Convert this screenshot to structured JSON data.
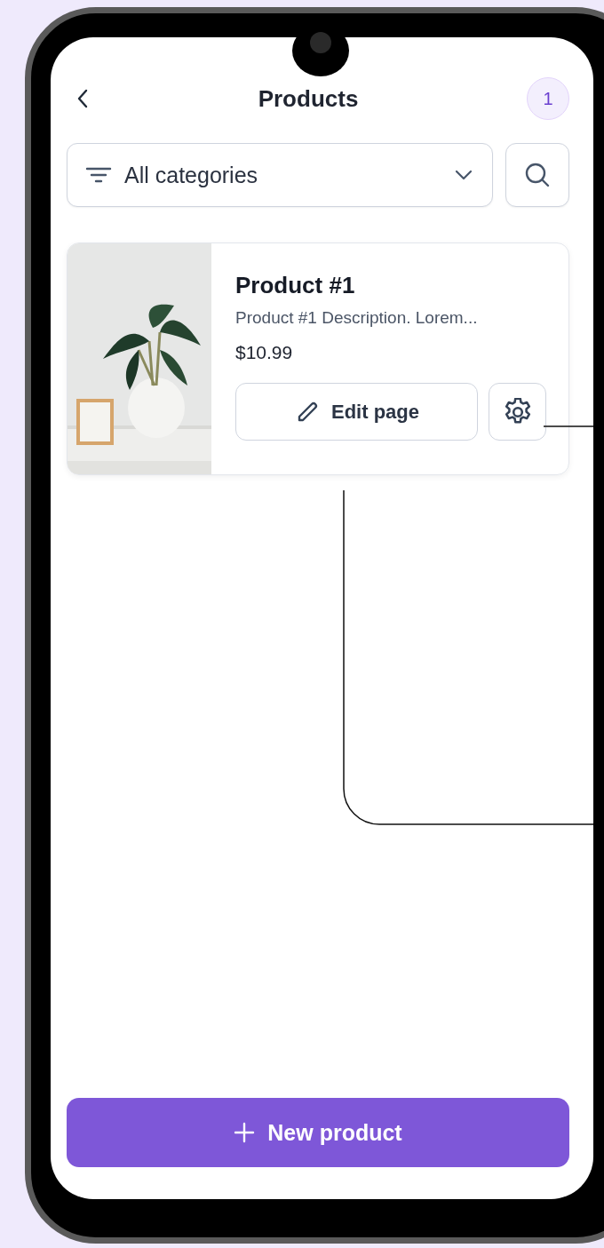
{
  "header": {
    "title": "Products",
    "badge": "1"
  },
  "filter": {
    "value": "All categories"
  },
  "products": [
    {
      "kind": "picture",
      "title": "Product #1",
      "description": "Product #1 Description. Lorem...",
      "price": "$10.99",
      "edit_label": "Edit page"
    }
  ],
  "new_product_button": {
    "label": "New product"
  }
}
